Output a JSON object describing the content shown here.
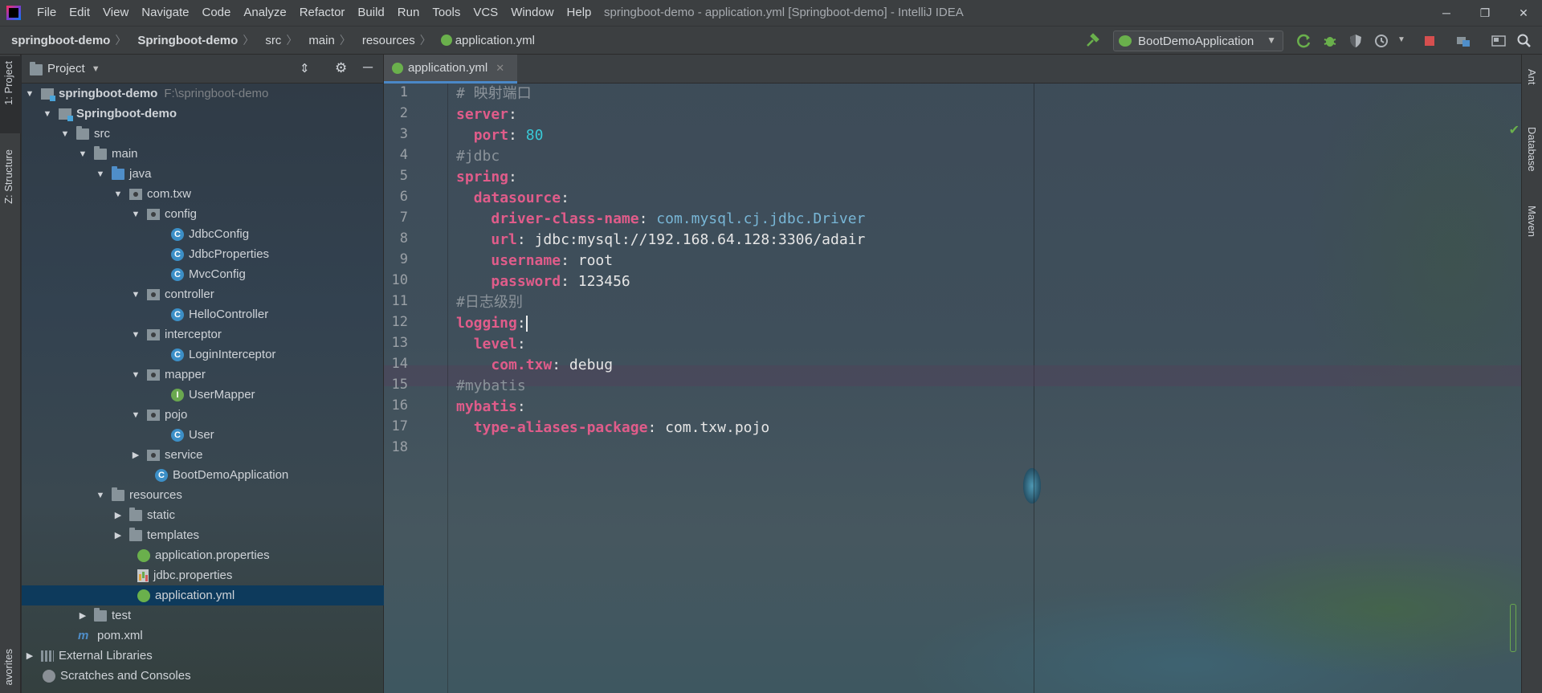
{
  "window": {
    "title": "springboot-demo - application.yml [Springboot-demo] - IntelliJ IDEA",
    "minimize": "─",
    "maximize": "❐",
    "close": "✕"
  },
  "menu": [
    "File",
    "Edit",
    "View",
    "Navigate",
    "Code",
    "Analyze",
    "Refactor",
    "Build",
    "Run",
    "Tools",
    "VCS",
    "Window",
    "Help"
  ],
  "breadcrumb": [
    "springboot-demo",
    "Springboot-demo",
    "src",
    "main",
    "resources",
    "application.yml"
  ],
  "run_config": {
    "label": "BootDemoApplication"
  },
  "left_stripe": {
    "project_tab": "1: Project",
    "structure_tab": "Z: Structure",
    "favorites_tab": "avorites"
  },
  "right_stripe": {
    "ant_tab": "Ant",
    "database_tab": "Database",
    "maven_tab": "Maven"
  },
  "project_panel": {
    "title": "Project",
    "tree": [
      {
        "label": "springboot-demo",
        "extra": "F:\\springboot-demo",
        "bold": true
      },
      {
        "label": "Springboot-demo",
        "bold": true
      },
      {
        "label": "src"
      },
      {
        "label": "main"
      },
      {
        "label": "java"
      },
      {
        "label": "com.txw"
      },
      {
        "label": "config"
      },
      {
        "label": "JdbcConfig"
      },
      {
        "label": "JdbcProperties"
      },
      {
        "label": "MvcConfig"
      },
      {
        "label": "controller"
      },
      {
        "label": "HelloController"
      },
      {
        "label": "interceptor"
      },
      {
        "label": "LoginInterceptor"
      },
      {
        "label": "mapper"
      },
      {
        "label": "UserMapper"
      },
      {
        "label": "pojo"
      },
      {
        "label": "User"
      },
      {
        "label": "service"
      },
      {
        "label": "BootDemoApplication"
      },
      {
        "label": "resources"
      },
      {
        "label": "static"
      },
      {
        "label": "templates"
      },
      {
        "label": "application.properties"
      },
      {
        "label": "jdbc.properties"
      },
      {
        "label": "application.yml"
      },
      {
        "label": "test"
      },
      {
        "label": "pom.xml"
      },
      {
        "label": "External Libraries"
      },
      {
        "label": "Scratches and Consoles"
      }
    ]
  },
  "editor": {
    "tab_label": "application.yml",
    "line_numbers": [
      "1",
      "2",
      "3",
      "4",
      "5",
      "6",
      "7",
      "8",
      "9",
      "10",
      "11",
      "12",
      "13",
      "14",
      "15",
      "16",
      "17",
      "18"
    ],
    "code": {
      "l1": "# 映射端口",
      "l2_key": "server",
      "l3_key": "port",
      "l3_val": "80",
      "l4": "#jdbc",
      "l5_key": "spring",
      "l6_key": "datasource",
      "l7_key": "driver-class-name",
      "l7_val": "com.mysql.cj.jdbc.Driver",
      "l8_key": "url",
      "l8_val": "jdbc:mysql://192.168.64.128:3306/adair",
      "l9_key": "username",
      "l9_val": "root",
      "l10_key": "password",
      "l10_val": "123456",
      "l11": "#日志级别",
      "l12_key": "logging",
      "l13_key": "level",
      "l14_key": "com.txw",
      "l14_val": "debug",
      "l15": "#mybatis",
      "l16_key": "mybatis",
      "l17_key": "type-aliases-package",
      "l17_val": "com.txw.pojo"
    }
  },
  "colors": {
    "selection": "#0d3a5c",
    "keyword": "#e05c8a",
    "comment": "#8b939a",
    "number": "#39c8d6",
    "tab_underline": "#4a88c7"
  }
}
